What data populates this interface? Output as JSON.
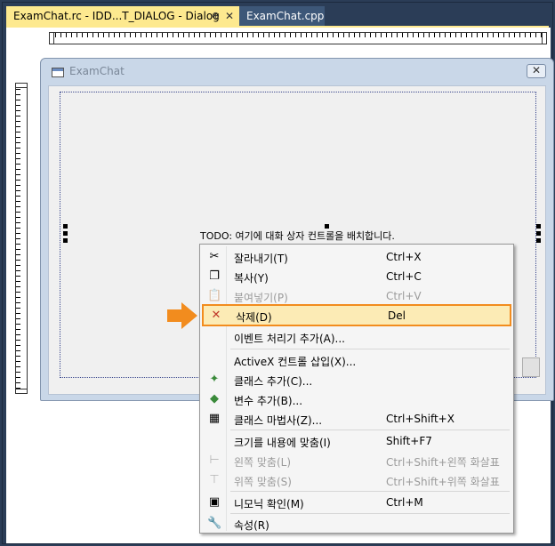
{
  "tabs": [
    {
      "label": "ExamChat.rc - IDD...T_DIALOG - Dialog",
      "pin": "⊕",
      "close": "✕"
    },
    {
      "label": "ExamChat.cpp"
    }
  ],
  "dialog": {
    "title": "ExamChat",
    "close": "✕",
    "todo": "TODO: 여기에 대화 상자 컨트롤을 배치합니다."
  },
  "menu": {
    "items": [
      {
        "icon": "scissors-icon",
        "glyph": "✂",
        "label": "잘라내기(T)",
        "shortcut": "Ctrl+X",
        "disabled": false
      },
      {
        "icon": "copy-icon",
        "glyph": "❐",
        "label": "복사(Y)",
        "shortcut": "Ctrl+C",
        "disabled": false
      },
      {
        "icon": "paste-icon",
        "glyph": "📋",
        "label": "붙여넣기(P)",
        "shortcut": "Ctrl+V",
        "disabled": true
      },
      {
        "icon": "delete-icon",
        "glyph": "✕",
        "label": "삭제(D)",
        "shortcut": "Del",
        "disabled": false
      },
      {
        "icon": "",
        "glyph": "",
        "label": "이벤트 처리기 추가(A)...",
        "shortcut": "",
        "disabled": false
      },
      {
        "icon": "",
        "glyph": "",
        "label": "ActiveX 컨트롤 삽입(X)...",
        "shortcut": "",
        "disabled": false
      },
      {
        "icon": "add-class-icon",
        "glyph": "✦",
        "label": "클래스 추가(C)...",
        "shortcut": "",
        "disabled": false
      },
      {
        "icon": "add-variable-icon",
        "glyph": "◆",
        "label": "변수 추가(B)...",
        "shortcut": "",
        "disabled": false
      },
      {
        "icon": "class-wizard-icon",
        "glyph": "▦",
        "label": "클래스 마법사(Z)...",
        "shortcut": "Ctrl+Shift+X",
        "disabled": false
      },
      {
        "icon": "",
        "glyph": "",
        "label": "크기를 내용에 맞춤(I)",
        "shortcut": "Shift+F7",
        "disabled": false
      },
      {
        "icon": "align-left-icon",
        "glyph": "⊢",
        "label": "왼쪽 맞춤(L)",
        "shortcut": "Ctrl+Shift+왼쪽 화살표",
        "disabled": true
      },
      {
        "icon": "align-top-icon",
        "glyph": "⊤",
        "label": "위쪽 맞춤(S)",
        "shortcut": "Ctrl+Shift+위쪽 화살표",
        "disabled": true
      },
      {
        "icon": "mnemonic-icon",
        "glyph": "▣",
        "label": "니모닉 확인(M)",
        "shortcut": "Ctrl+M",
        "disabled": false
      },
      {
        "icon": "wrench-icon",
        "glyph": "🔧",
        "label": "속성(R)",
        "shortcut": "",
        "disabled": false
      }
    ]
  },
  "colors": {
    "active_tab": "#fde98f",
    "highlight_border": "#f28c1e",
    "highlight_fill": "#fcebb5",
    "delete_icon": "#c0392b",
    "arrow": "#f28c1e"
  }
}
